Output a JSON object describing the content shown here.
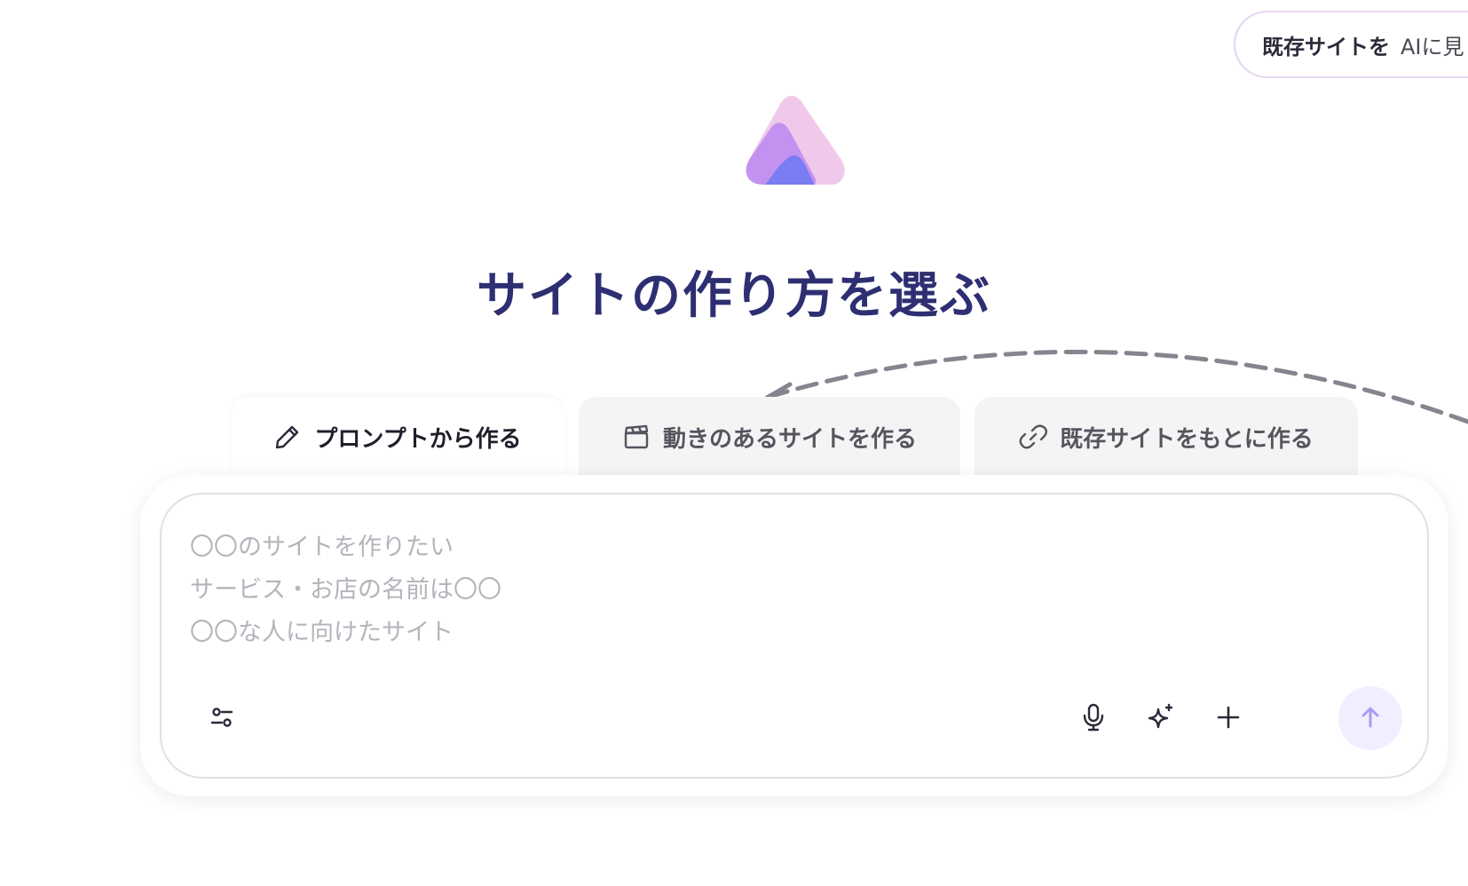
{
  "top_pill": {
    "strong": "既存サイトを",
    "light": "AIに見"
  },
  "page_title": "サイトの作り方を選ぶ",
  "tabs": [
    {
      "label": "プロンプトから作る",
      "icon": "pencil-icon",
      "active": true
    },
    {
      "label": "動きのあるサイトを作る",
      "icon": "clapperboard-icon",
      "active": false
    },
    {
      "label": "既存サイトをもとに作る",
      "icon": "link-icon",
      "active": false
    }
  ],
  "composer": {
    "placeholder": "〇〇のサイトを作りたい\nサービス・お店の名前は〇〇\n〇〇な人に向けたサイト",
    "value": ""
  },
  "toolbar": {
    "settings_icon": "sliders-icon",
    "mic_icon": "microphone-icon",
    "sparkle_icon": "sparkles-icon",
    "plus_icon": "plus-icon",
    "send_icon": "arrow-up-icon"
  },
  "colors": {
    "title": "#2e2f72",
    "accent_light": "#f1efff",
    "accent": "#a99cf5",
    "logo_pink": "#f0c9ea",
    "logo_purple": "#c08ef0",
    "logo_blue": "#7a7cf2"
  }
}
